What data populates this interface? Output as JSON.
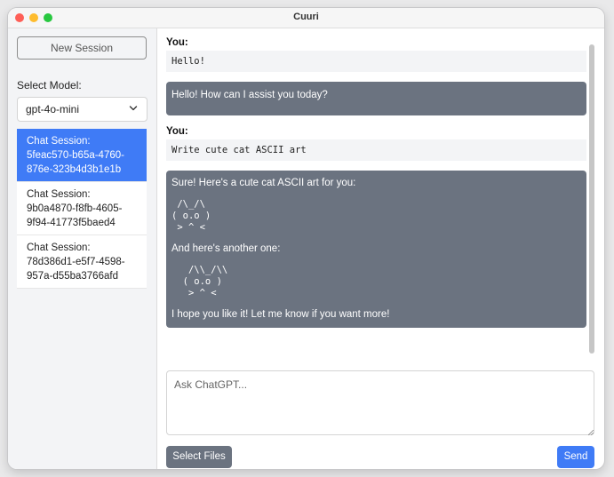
{
  "window": {
    "title": "Cuuri"
  },
  "sidebar": {
    "new_session_label": "New Session",
    "select_model_label": "Select Model:",
    "model": {
      "selected": "gpt-4o-mini"
    },
    "sessions": [
      {
        "label": "Chat Session: 5feac570-b65a-4760-876e-323b4d3b1e1b",
        "active": true
      },
      {
        "label": "Chat Session: 9b0a4870-f8fb-4605-9f94-41773f5baed4",
        "active": false
      },
      {
        "label": "Chat Session: 78d386d1-e5f7-4598-957a-d55ba3766afd",
        "active": false
      }
    ]
  },
  "messages": {
    "user_1_label": "You:",
    "user_1_text": "Hello!",
    "bot_1_text": "Hello! How can I assist you today?",
    "user_2_label": "You:",
    "user_2_text": "Write cute cat ASCII art",
    "bot_2": {
      "intro": "Sure! Here's a cute cat ASCII art for you:",
      "art_1": " /\\_/\\\n( o.o )\n > ^ <",
      "middle": "And here's another one:",
      "art_2": "   /\\\\_/\\\\\n  ( o.o )\n   > ^ <",
      "outro": "I hope you like it! Let me know if you want more!"
    }
  },
  "composer": {
    "placeholder": "Ask ChatGPT...",
    "value": ""
  },
  "actions": {
    "select_files_label": "Select Files",
    "send_label": "Send"
  },
  "colors": {
    "accent": "#3f7bf6",
    "assistant_bubble": "#6b7380",
    "sidebar_bg": "#f3f4f6"
  }
}
